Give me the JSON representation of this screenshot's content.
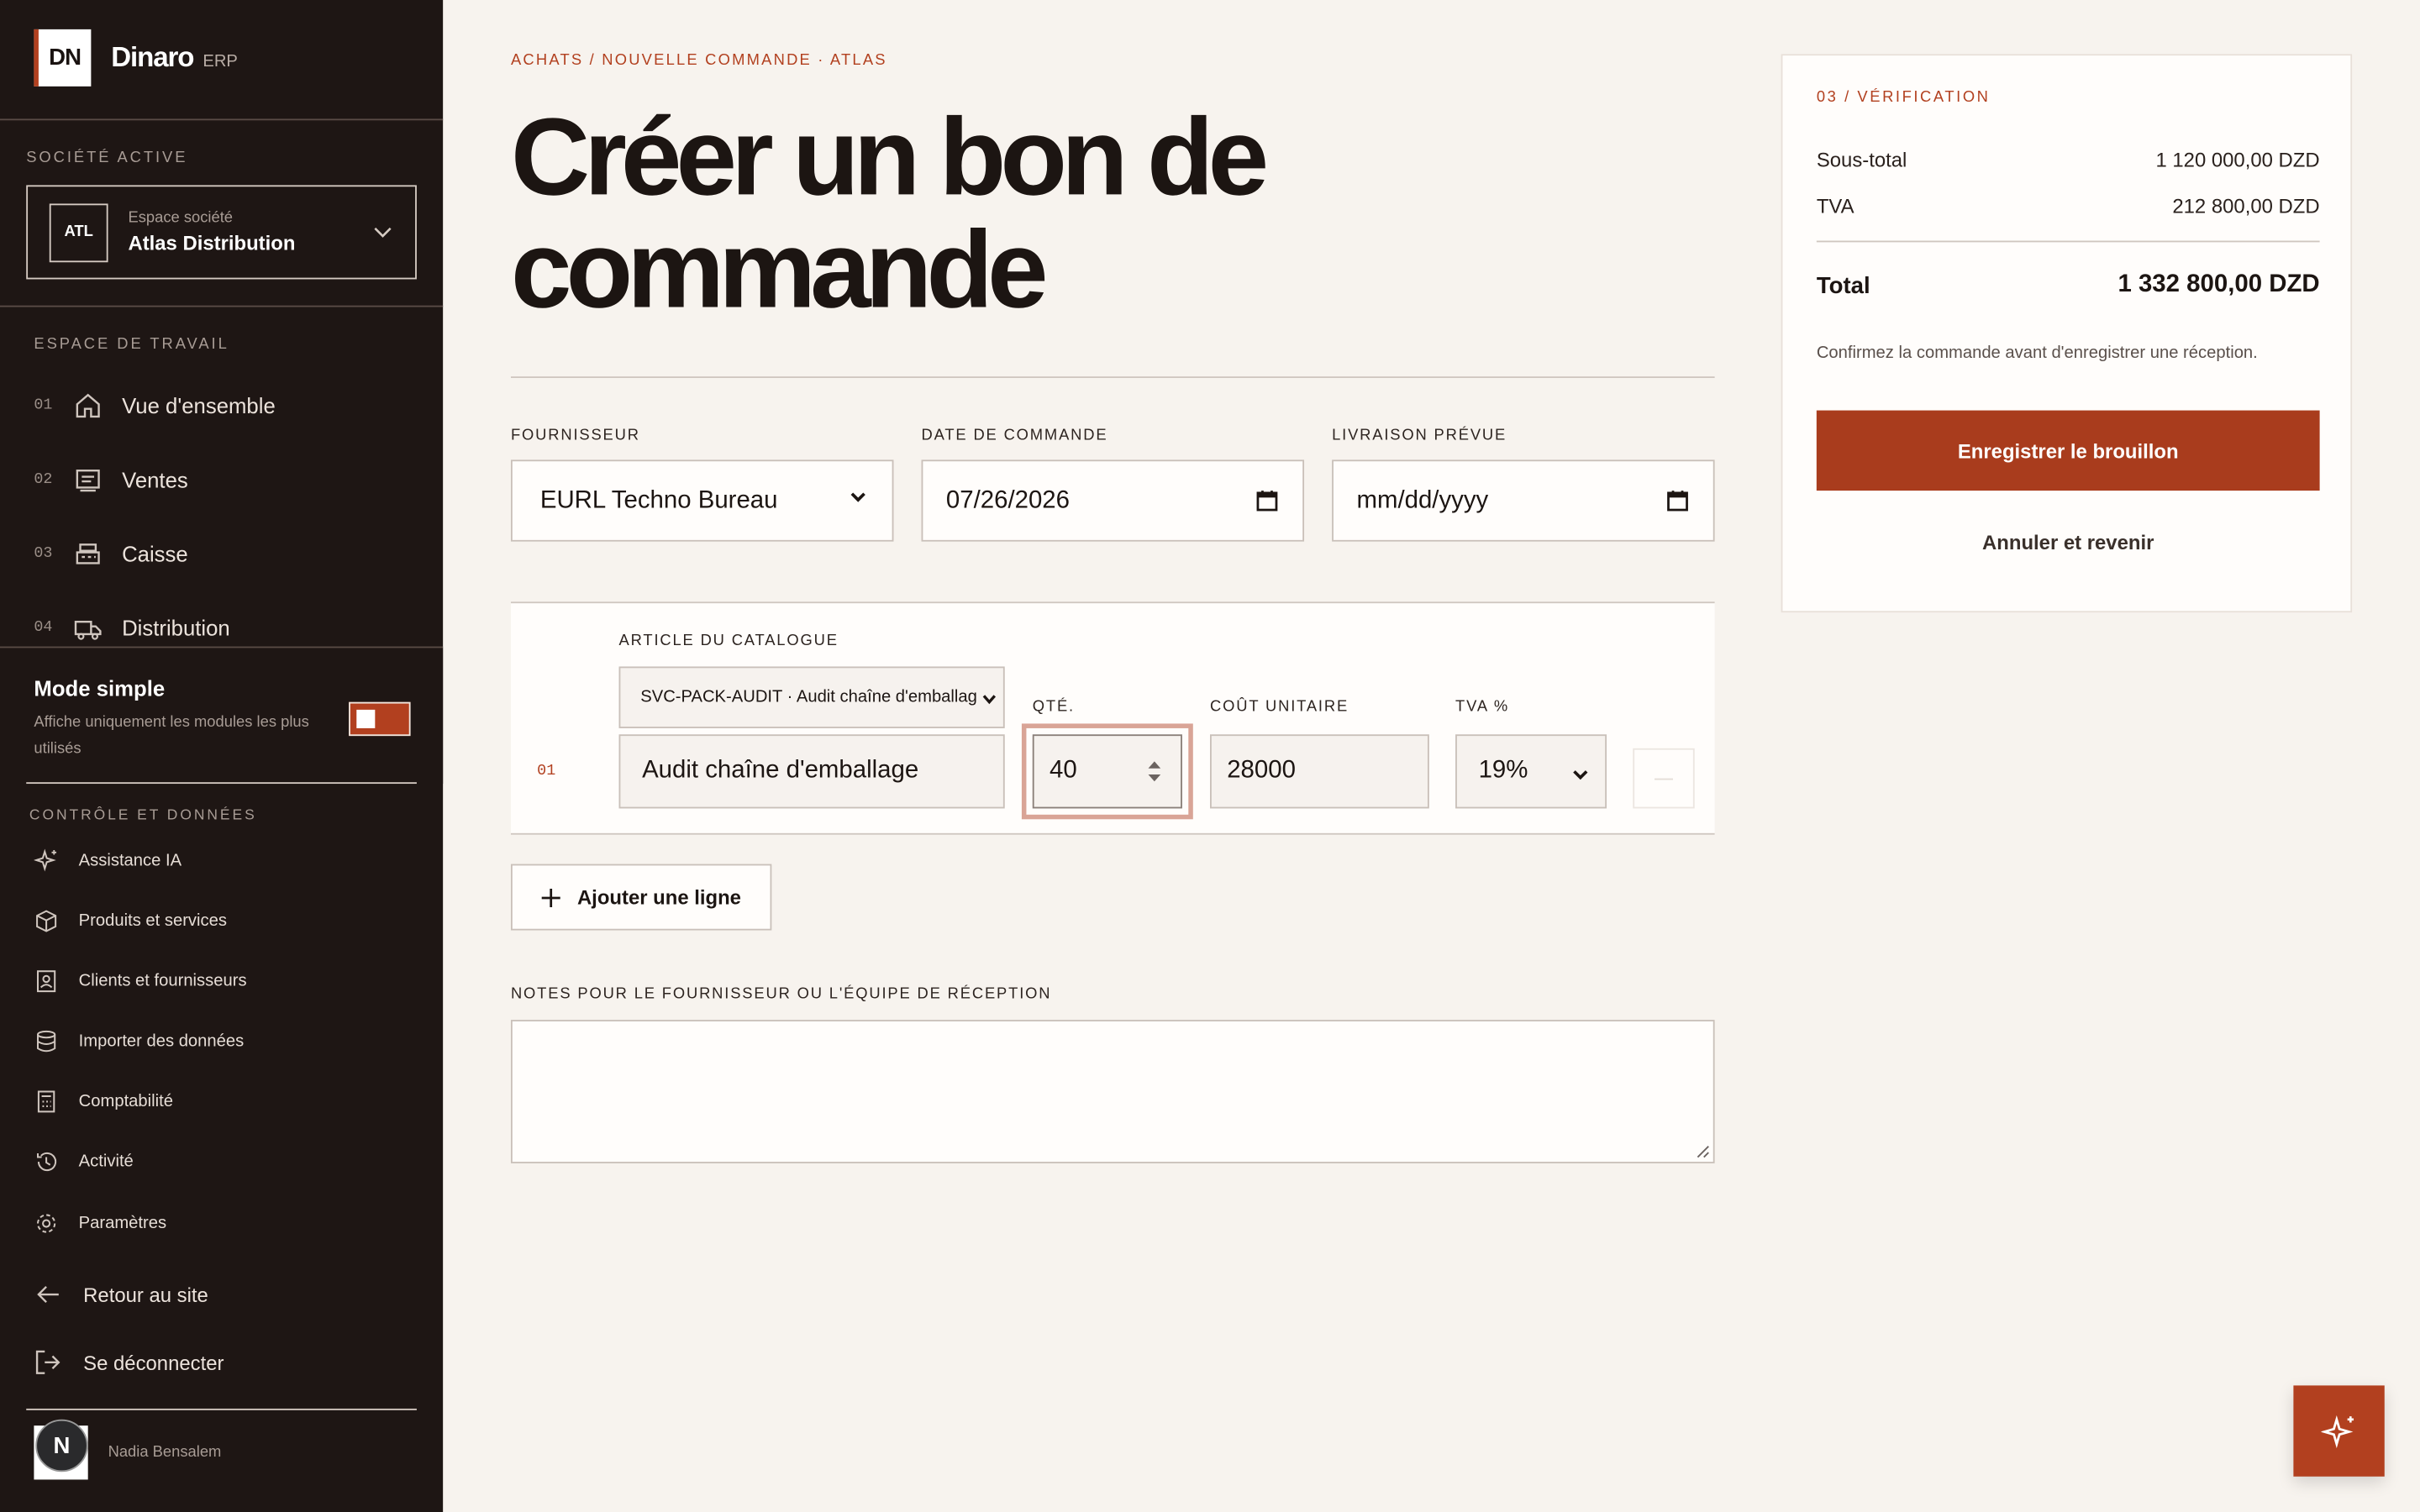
{
  "brand": {
    "logo": "DN",
    "name": "Dinaro",
    "sub": "ERP"
  },
  "sidebar": {
    "active_company_label": "SOCIÉTÉ ACTIVE",
    "company": {
      "badge": "ATL",
      "caption": "Espace société",
      "name": "Atlas Distribution"
    },
    "workspace_label": "ESPACE DE TRAVAIL",
    "nav": [
      {
        "num": "01",
        "label": "Vue d'ensemble",
        "icon": "home-icon"
      },
      {
        "num": "02",
        "label": "Ventes",
        "icon": "receipt-icon"
      },
      {
        "num": "03",
        "label": "Caisse",
        "icon": "register-icon"
      },
      {
        "num": "04",
        "label": "Distribution",
        "icon": "truck-icon"
      }
    ],
    "simple_mode": {
      "title": "Mode simple",
      "desc": "Affiche uniquement les modules les plus utilisés",
      "enabled": true
    },
    "controls_label": "CONTRÔLE ET DONNÉES",
    "tools": [
      {
        "label": "Assistance IA",
        "icon": "sparkle-icon"
      },
      {
        "label": "Produits et services",
        "icon": "box-icon"
      },
      {
        "label": "Clients et fournisseurs",
        "icon": "contacts-icon"
      },
      {
        "label": "Importer des données",
        "icon": "database-icon"
      },
      {
        "label": "Comptabilité",
        "icon": "calculator-icon"
      },
      {
        "label": "Activité",
        "icon": "history-icon"
      },
      {
        "label": "Paramètres",
        "icon": "gear-icon"
      }
    ],
    "back": "Retour au site",
    "logout": "Se déconnecter",
    "user": {
      "initial": "N",
      "name": "Nadia Bensalem"
    }
  },
  "main": {
    "breadcrumb": "ACHATS / NOUVELLE COMMANDE · ATLAS",
    "title": "Créer un bon de commande",
    "supplier_label": "FOURNISSEUR",
    "supplier_value": "EURL Techno Bureau",
    "order_date_label": "DATE DE COMMANDE",
    "order_date_value": "07/26/2026",
    "delivery_label": "LIVRAISON PRÉVUE",
    "delivery_placeholder": "mm/dd/yyyy",
    "line": {
      "index": "01",
      "catalog_label": "ARTICLE DU CATALOGUE",
      "catalog_value": "SVC-PACK-AUDIT · Audit chaîne d'emballag",
      "description": "Audit chaîne d'emballage",
      "qty_label": "QTÉ.",
      "qty": "40",
      "unit_cost_label": "COÛT UNITAIRE",
      "unit_cost": "28000",
      "vat_label": "TVA %",
      "vat": "19%"
    },
    "add_line": "Ajouter une ligne",
    "notes_label": "NOTES POUR LE FOURNISSEUR OU L'ÉQUIPE DE RÉCEPTION",
    "notes_value": ""
  },
  "summary": {
    "label": "03 / VÉRIFICATION",
    "subtotal_label": "Sous-total",
    "subtotal": "1 120 000,00 DZD",
    "vat_label": "TVA",
    "vat": "212 800,00 DZD",
    "total_label": "Total",
    "total": "1 332 800,00 DZD",
    "note": "Confirmez la commande avant d'enregistrer une réception.",
    "save": "Enregistrer le brouillon",
    "cancel": "Annuler et revenir"
  },
  "colors": {
    "accent": "#b2401f",
    "sidebar": "#1e1614",
    "background": "#f7f3ee"
  }
}
